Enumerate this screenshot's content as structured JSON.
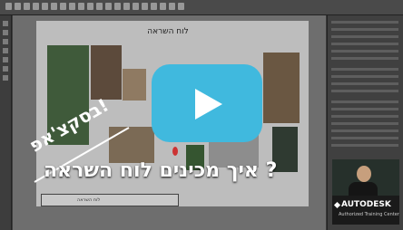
{
  "video": {
    "badge_text": "בסקצ'אפ!",
    "headline": "איך מכינים לוח השראה ?",
    "sheet_title": "לוח השראה",
    "title_block_text": "לוח השראה",
    "brand_main": "AUTODESK",
    "brand_sub": "Authorized Training Center"
  },
  "icons": {
    "play": "play-icon",
    "brand_logo": "autodesk-logo-icon"
  },
  "colors": {
    "play_button": "#40b9de",
    "canvas": "#6e6e6e",
    "sheet": "#bdbdbd"
  }
}
